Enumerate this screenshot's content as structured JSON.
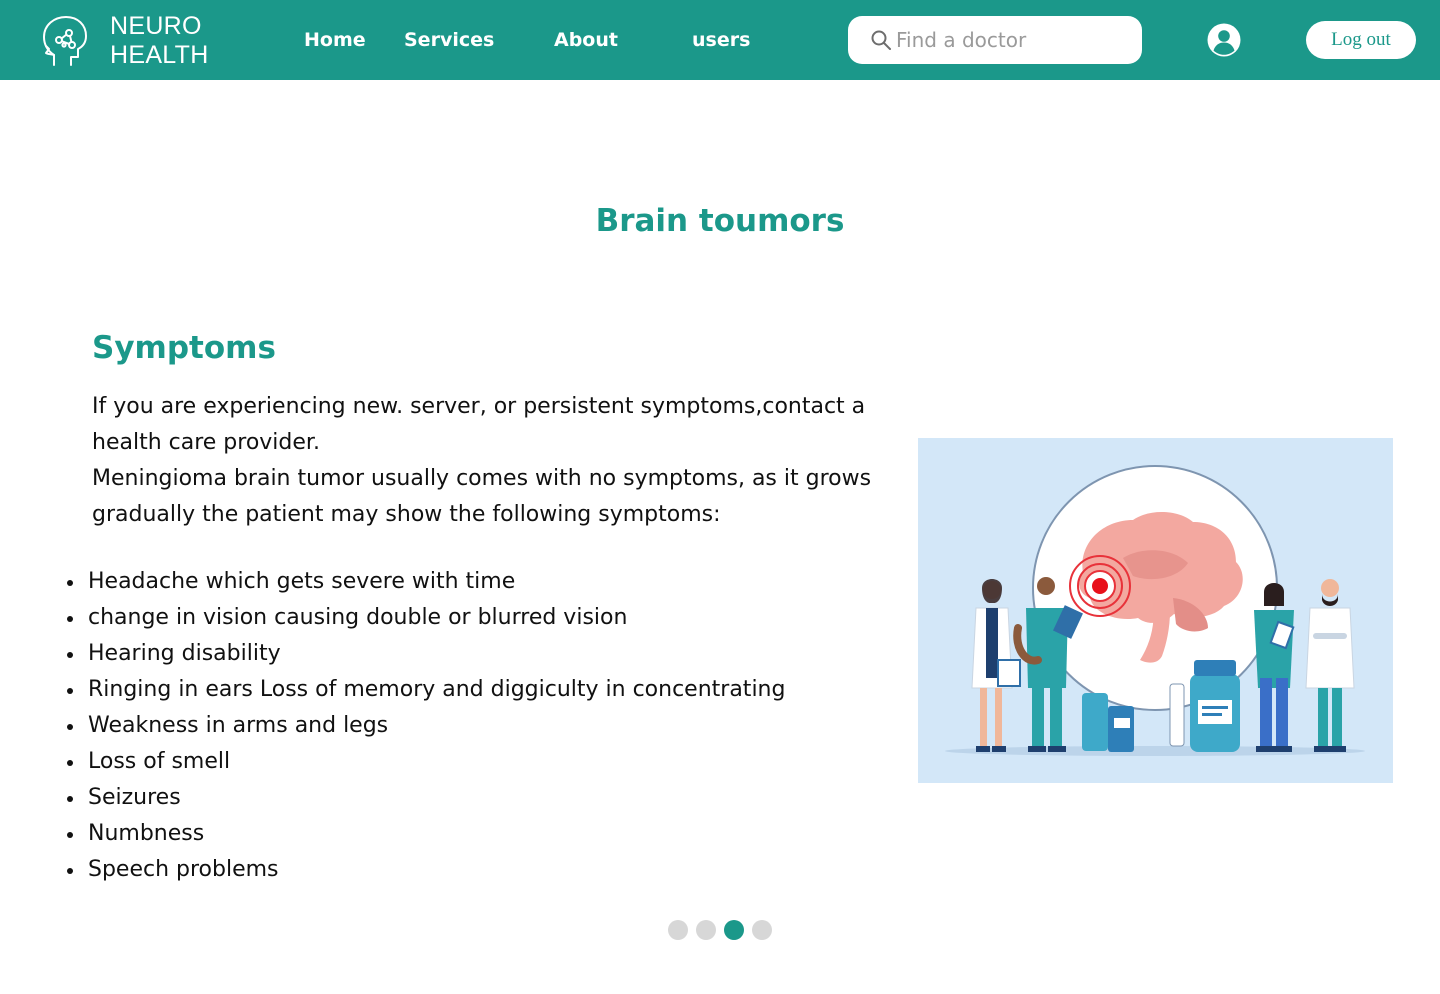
{
  "header": {
    "logo_line1": "NEURO",
    "logo_line2": "HEALTH",
    "nav": [
      {
        "label": "Home"
      },
      {
        "label": "Services"
      },
      {
        "label": "About"
      },
      {
        "label": "users"
      }
    ],
    "search_placeholder": "Find a doctor",
    "logout_label": "Log out"
  },
  "page": {
    "title": "Brain toumors",
    "section_title": "Symptoms",
    "intro_1": "If you are experiencing new. server, or persistent symptoms,contact a health care provider.",
    "intro_2": "Meningioma brain tumor usually comes with no symptoms, as it grows gradually the patient may show the following symptoms:",
    "symptoms": [
      "Headache which gets severe with time",
      "change in vision causing double or blurred vision",
      "Hearing disability",
      "Ringing in ears Loss of memory and diggiculty in concentrating",
      "Weakness in arms and legs",
      "Loss of smell",
      "Seizures",
      "Numbness",
      "Speech problems"
    ]
  },
  "carousel": {
    "active_index": 2,
    "count": 4
  },
  "colors": {
    "brand": "#1b988a",
    "illustration_bg": "#d3e7f8",
    "dot_inactive": "#d7d7d7"
  },
  "icons": {
    "logo": "head-network-icon",
    "search": "search-icon",
    "user": "user-circle-icon"
  }
}
